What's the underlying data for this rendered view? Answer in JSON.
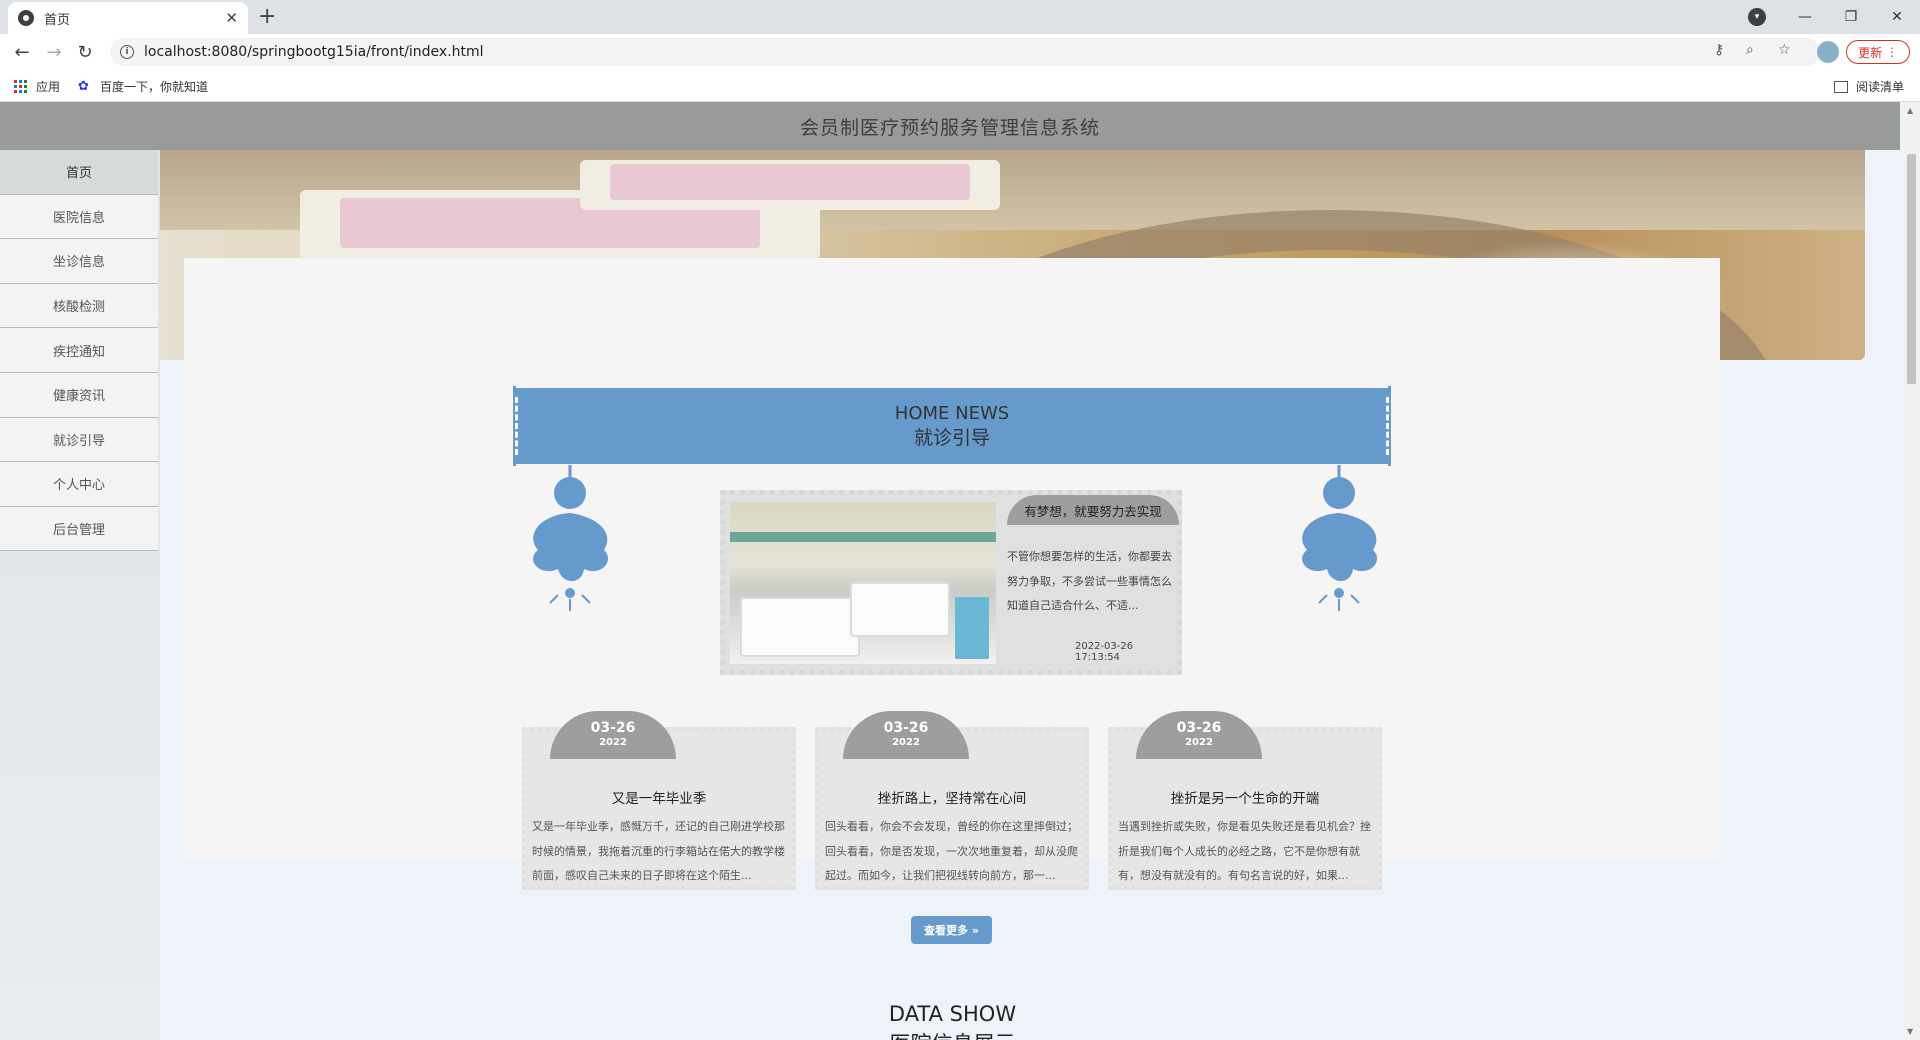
{
  "browser": {
    "tab_title": "首页",
    "tab_close": "✕",
    "new_tab": "+",
    "url": "localhost:8080/springbootg15ia/front/index.html",
    "update_label": "更新",
    "bookmarks": [
      {
        "label": "应用",
        "icon": "apps-grid-icon"
      },
      {
        "label": "百度一下，你就知道",
        "icon": "baidu-paw-icon"
      }
    ],
    "reading_list": "阅读清单"
  },
  "site": {
    "title": "会员制医疗预约服务管理信息系统"
  },
  "menu": [
    {
      "label": "首页",
      "active": true
    },
    {
      "label": "医院信息"
    },
    {
      "label": "坐诊信息"
    },
    {
      "label": "核酸检测"
    },
    {
      "label": "疾控通知"
    },
    {
      "label": "健康资讯"
    },
    {
      "label": "就诊引导"
    },
    {
      "label": "个人中心"
    },
    {
      "label": "后台管理"
    }
  ],
  "banner": {
    "slide_count": 3,
    "active_slide": 1
  },
  "news": {
    "heading_en": "HOME NEWS",
    "heading_cn": "就诊引导",
    "featured": {
      "title": "有梦想，就要努力去实现",
      "text": "不管你想要怎样的生活，你都要去努力争取，不多尝试一些事情怎么知道自己适合什么、不适...",
      "date": "2022-03-26 17:13:54"
    },
    "cards": [
      {
        "month_day": "03-26",
        "year": "2022",
        "title": "又是一年毕业季",
        "text": "又是一年毕业季，感慨万千，还记的自己刚进学校那时候的情景，我拖着沉重的行李箱站在偌大的教学楼前面，感叹自己未来的日子即将在这个陌生..."
      },
      {
        "month_day": "03-26",
        "year": "2022",
        "title": "挫折路上，坚持常在心间",
        "text": "回头看看，你会不会发现，曾经的你在这里摔倒过；回头看看，你是否发现，一次次地重复着，却从没爬起过。而如今，让我们把视线转向前方，那一..."
      },
      {
        "month_day": "03-26",
        "year": "2022",
        "title": "挫折是另一个生命的开端",
        "text": "当遇到挫折或失败，你是看见失败还是看见机会？挫折是我们每个人成长的必经之路，它不是你想有就有，想没有就没有的。有句名言说的好，如果..."
      }
    ],
    "more_label": "查看更多 »"
  },
  "data_show": {
    "heading_en": "DATA SHOW",
    "heading_cn": "医院信息展示"
  },
  "colors": {
    "accent": "#6699cc",
    "header_bg": "#999b9a",
    "card_badge": "#9e9e9e"
  }
}
